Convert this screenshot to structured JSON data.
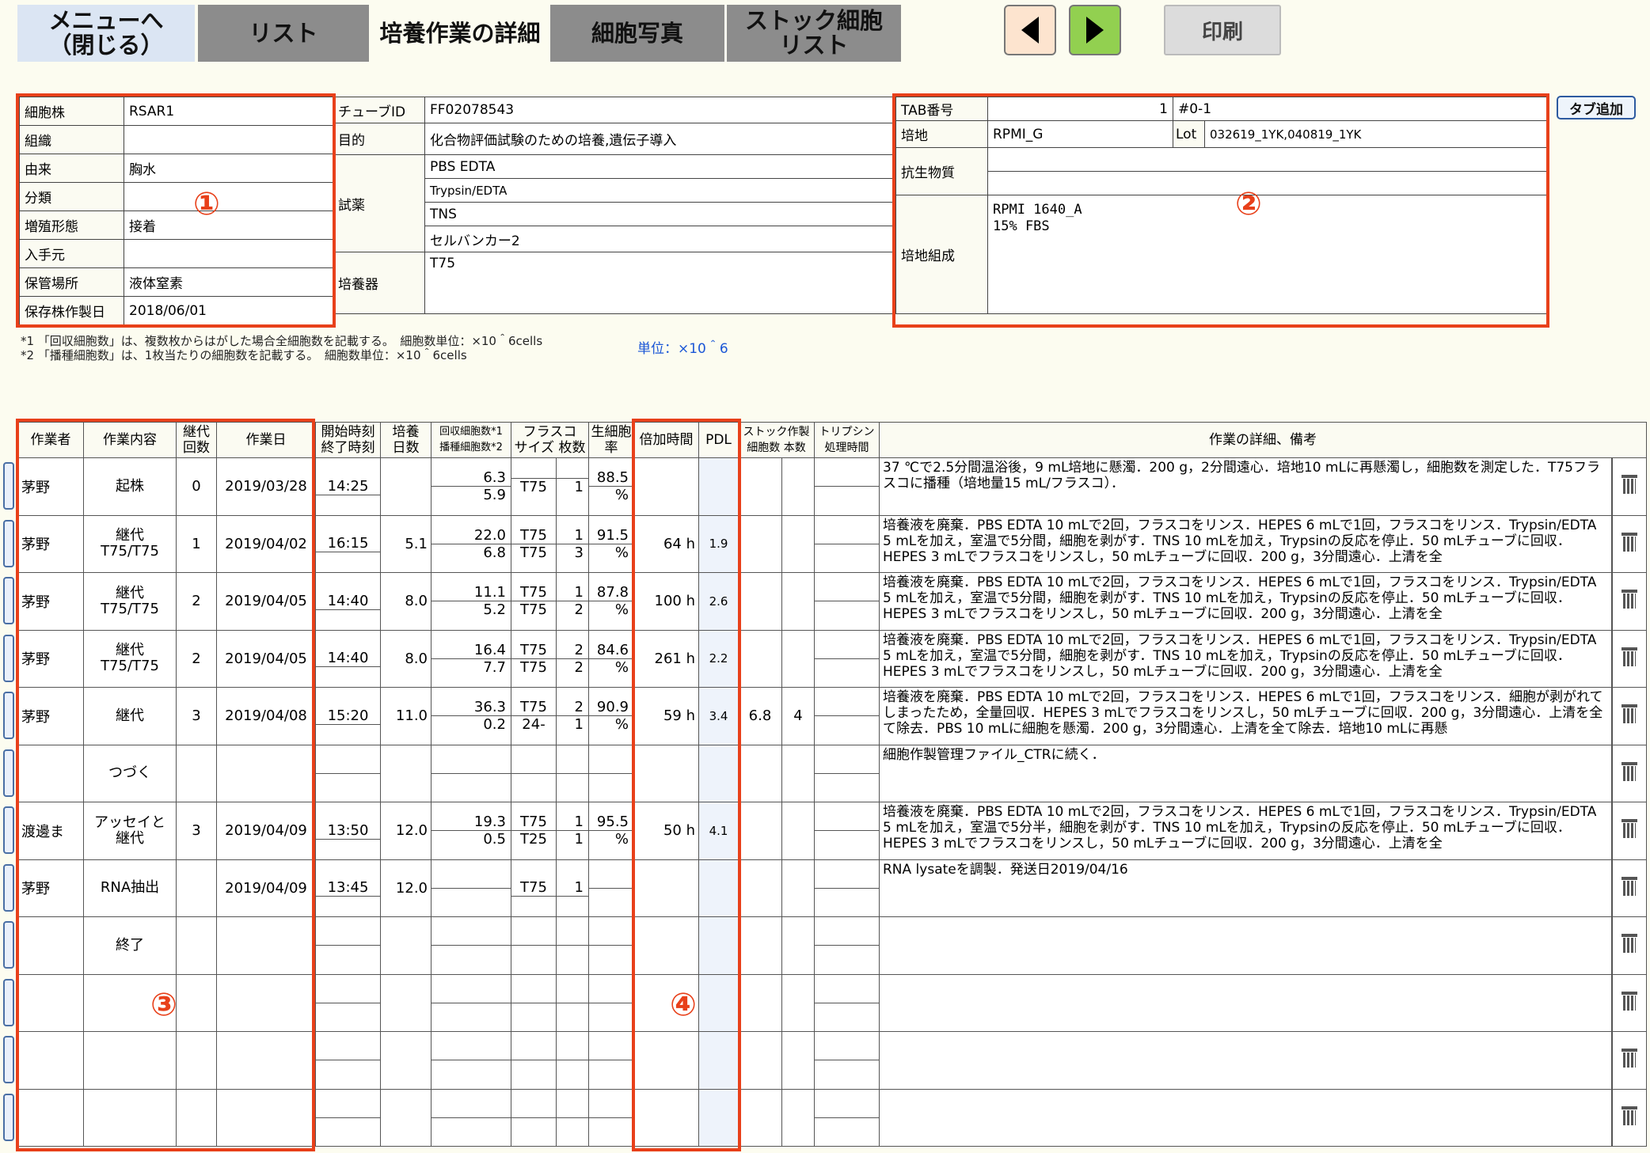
{
  "tabs": [
    {
      "label": "メニューへ\n（閉じる）"
    },
    {
      "label": "リスト"
    },
    {
      "label": "培養作業の詳細"
    },
    {
      "label": "細胞写真"
    },
    {
      "label": "ストック細胞\nリスト"
    }
  ],
  "toolbar": {
    "print_label": "印刷",
    "prev_icon": "triangle-left",
    "next_icon": "triangle-right"
  },
  "colors": {
    "accent_red": "#e8401a",
    "next_green": "#92d050",
    "prev_peach": "#fde4cf"
  },
  "cell_info": [
    {
      "label": "細胞株",
      "value": "RSAR1"
    },
    {
      "label": "組織",
      "value": ""
    },
    {
      "label": "由来",
      "value": "胸水"
    },
    {
      "label": "分類",
      "value": ""
    },
    {
      "label": "増殖形態",
      "value": "接着"
    },
    {
      "label": "入手元",
      "value": ""
    },
    {
      "label": "保管場所",
      "value": "液体窒素"
    },
    {
      "label": "保存株作製日",
      "value": "2018/06/01"
    }
  ],
  "tube": {
    "id_label": "チューブID",
    "id_value": "FF02078543",
    "purpose_label": "目的",
    "purpose_value": "化合物評価試験のための培養,遺伝子導入",
    "reagent_label": "試薬",
    "reagents": [
      "PBS EDTA",
      "Trypsin/EDTA",
      "TNS",
      "セルバンカー2"
    ],
    "vessel_label": "培養器",
    "vessel_value": "T75"
  },
  "medium": {
    "tab_label": "TAB番号",
    "tab_no": "1",
    "tab_code": "#0-1",
    "medium_label": "培地",
    "medium_value": "RPMI_G",
    "lot_label": "Lot",
    "lot_value": "032619_1YK,040819_1YK",
    "antibiotic_label": "抗生物質",
    "composition_label": "培地組成",
    "composition": [
      "RPMI 1640_A",
      "15% FBS"
    ],
    "add_tab_label": "タブ追加"
  },
  "notes": [
    "*1 「回収細胞数」は、複数枚からはがした場合全細胞数を記載する。　細胞数単位：×10＾6cells",
    "*2 「播種細胞数」は、1枚当たりの細胞数を記載する。　細胞数単位：×10＾6cells"
  ],
  "unit_label": "単位：×10＾6",
  "annotations": [
    "①",
    "②",
    "③",
    "④"
  ],
  "log_headers": {
    "worker": "作業者",
    "task": "作業内容",
    "passage": "継代\n回数",
    "date": "作業日",
    "time": "開始時刻\n終了時刻",
    "days": "培養\n日数",
    "cells": "回収細胞数*1\n播種細胞数*2",
    "flask": "フラスコ\nサイズ 枚数",
    "via": "生細胞\n率",
    "dbl": "倍加時間",
    "pdl": "PDL",
    "stock": "ストック作製\n細胞数 本数",
    "tryp": "トリプシン\n処理時間",
    "detail": "作業の詳細、備考"
  },
  "log_rows": [
    {
      "worker": "茅野",
      "task": "起株",
      "passage": "0",
      "date": "2019/03/28",
      "start": "14:25",
      "days": "",
      "rec": "6.3",
      "seed": "5.9",
      "size1": "",
      "n1": "",
      "size2": "T75",
      "n2": "1",
      "via": "88.5",
      "dbl": "",
      "pdl": "",
      "scells": "",
      "snum": "",
      "detail": "37 ℃で2.5分間温浴後，9 mL培地に懸濁．200 g，2分間遠心．培地10 mLに再懸濁し，細胞数を測定した．T75フラスコに播種（培地量15 mL/フラスコ）．"
    },
    {
      "worker": "茅野",
      "task": "継代\nT75/T75",
      "passage": "1",
      "date": "2019/04/02",
      "start": "16:15",
      "days": "5.1",
      "rec": "22.0",
      "seed": "6.8",
      "size1": "T75",
      "n1": "1",
      "size2": "T75",
      "n2": "3",
      "via": "91.5",
      "dbl": "64 h",
      "pdl": "1.9",
      "scells": "",
      "snum": "",
      "detail": "培養液を廃棄．PBS EDTA 10 mLで2回，フラスコをリンス．HEPES 6 mLで1回，フラスコをリンス．Trypsin/EDTA 5 mLを加え，室温で5分間，細胞を剥がす．TNS 10 mLを加え，Trypsinの反応を停止．50 mLチューブに回収．HEPES 3 mLでフラスコをリンスし，50 mLチューブに回収．200 g，3分間遠心．上清を全"
    },
    {
      "worker": "茅野",
      "task": "継代\nT75/T75",
      "passage": "2",
      "date": "2019/04/05",
      "start": "14:40",
      "days": "8.0",
      "rec": "11.1",
      "seed": "5.2",
      "size1": "T75",
      "n1": "1",
      "size2": "T75",
      "n2": "2",
      "via": "87.8",
      "dbl": "100 h",
      "pdl": "2.6",
      "scells": "",
      "snum": "",
      "detail": "培養液を廃棄．PBS EDTA 10 mLで2回，フラスコをリンス．HEPES 6 mLで1回，フラスコをリンス．Trypsin/EDTA 5 mLを加え，室温で5分間，細胞を剥がす．TNS 10 mLを加え，Trypsinの反応を停止．50 mLチューブに回収．HEPES 3 mLでフラスコをリンスし，50 mLチューブに回収．200 g，3分間遠心．上清を全"
    },
    {
      "worker": "茅野",
      "task": "継代\nT75/T75",
      "passage": "2",
      "date": "2019/04/05",
      "start": "14:40",
      "days": "8.0",
      "rec": "16.4",
      "seed": "7.7",
      "size1": "T75",
      "n1": "2",
      "size2": "T75",
      "n2": "2",
      "via": "84.6",
      "dbl": "261 h",
      "pdl": "2.2",
      "scells": "",
      "snum": "",
      "detail": "培養液を廃棄．PBS EDTA 10 mLで2回，フラスコをリンス．HEPES 6 mLで1回，フラスコをリンス．Trypsin/EDTA 5 mLを加え，室温で5分間，細胞を剥がす．TNS 10 mLを加え，Trypsinの反応を停止．50 mLチューブに回収．HEPES 3 mLでフラスコをリンスし，50 mLチューブに回収．200 g，3分間遠心．上清を全"
    },
    {
      "worker": "茅野",
      "task": "継代",
      "passage": "3",
      "date": "2019/04/08",
      "start": "15:20",
      "days": "11.0",
      "rec": "36.3",
      "seed": "0.2",
      "size1": "T75",
      "n1": "2",
      "size2": "24-",
      "n2": "1",
      "via": "90.9",
      "dbl": "59 h",
      "pdl": "3.4",
      "scells": "6.8",
      "snum": "4",
      "detail": "培養液を廃棄．PBS EDTA 10 mLで2回，フラスコをリンス．HEPES 6 mLで1回，フラスコをリンス．細胞が剥がれてしまったため，全量回収．HEPES 3 mLでフラスコをリンスし，50 mLチューブに回収．200 g，3分間遠心．上清を全て除去．PBS 10 mLに細胞を懸濁．200 g，3分間遠心．上清を全て除去．培地10 mLに再懸"
    },
    {
      "worker": "",
      "task": "つづく",
      "passage": "",
      "date": "",
      "start": "",
      "days": "",
      "rec": "",
      "seed": "",
      "size1": "",
      "n1": "",
      "size2": "",
      "n2": "",
      "via": "",
      "dbl": "",
      "pdl": "",
      "scells": "",
      "snum": "",
      "detail": "細胞作製管理ファイル_CTRに続く．"
    },
    {
      "worker": "渡邊ま",
      "task": "アッセイと\n継代",
      "passage": "3",
      "date": "2019/04/09",
      "start": "13:50",
      "days": "12.0",
      "rec": "19.3",
      "seed": "0.5",
      "size1": "T75",
      "n1": "1",
      "size2": "T25",
      "n2": "1",
      "via": "95.5",
      "dbl": "50 h",
      "pdl": "4.1",
      "scells": "",
      "snum": "",
      "detail": "培養液を廃棄．PBS EDTA 10 mLで2回，フラスコをリンス．HEPES 6 mLで1回，フラスコをリンス．Trypsin/EDTA 5 mLを加え，室温で5分半，細胞を剥がす．TNS 10 mLを加え，Trypsinの反応を停止．50 mLチューブに回収．HEPES 3 mLでフラスコをリンスし，50 mLチューブに回収．200 g，3分間遠心．上清を全"
    },
    {
      "worker": "茅野",
      "task": "RNA抽出",
      "passage": "",
      "date": "2019/04/09",
      "start": "13:45",
      "days": "12.0",
      "rec": "",
      "seed": "",
      "size1": "T75",
      "n1": "1",
      "size2": "",
      "n2": "",
      "via": "",
      "dbl": "",
      "pdl": "",
      "scells": "",
      "snum": "",
      "detail": "RNA lysateを調製．発送日2019/04/16"
    },
    {
      "worker": "",
      "task": "終了",
      "passage": "",
      "date": "",
      "start": "",
      "days": "",
      "rec": "",
      "seed": "",
      "size1": "",
      "n1": "",
      "size2": "",
      "n2": "",
      "via": "",
      "dbl": "",
      "pdl": "",
      "scells": "",
      "snum": "",
      "detail": ""
    },
    {
      "worker": "",
      "task": "",
      "passage": "",
      "date": "",
      "start": "",
      "days": "",
      "rec": "",
      "seed": "",
      "size1": "",
      "n1": "",
      "size2": "",
      "n2": "",
      "via": "",
      "dbl": "",
      "pdl": "",
      "scells": "",
      "snum": "",
      "detail": ""
    },
    {
      "worker": "",
      "task": "",
      "passage": "",
      "date": "",
      "start": "",
      "days": "",
      "rec": "",
      "seed": "",
      "size1": "",
      "n1": "",
      "size2": "",
      "n2": "",
      "via": "",
      "dbl": "",
      "pdl": "",
      "scells": "",
      "snum": "",
      "detail": ""
    },
    {
      "worker": "",
      "task": "",
      "passage": "",
      "date": "",
      "start": "",
      "days": "",
      "rec": "",
      "seed": "",
      "size1": "",
      "n1": "",
      "size2": "",
      "n2": "",
      "via": "",
      "dbl": "",
      "pdl": "",
      "scells": "",
      "snum": "",
      "detail": ""
    }
  ],
  "percent": "%"
}
